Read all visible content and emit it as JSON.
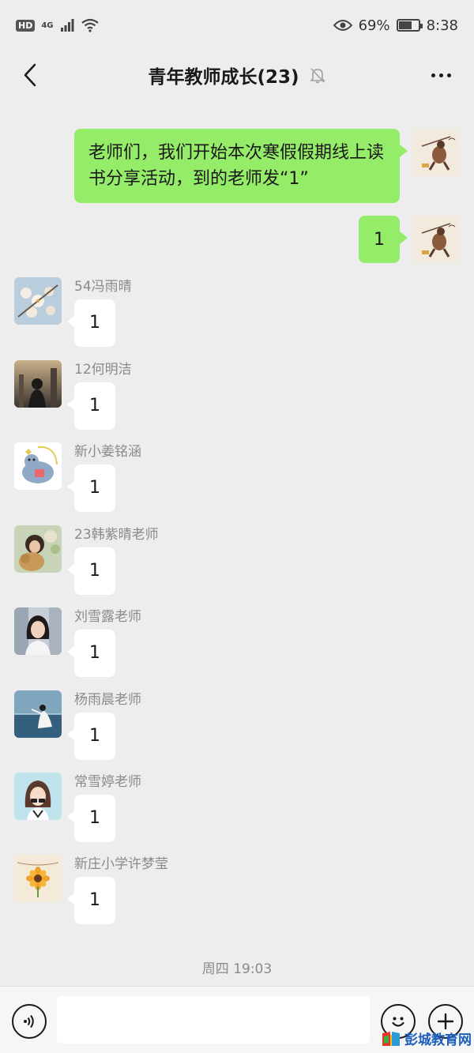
{
  "status_bar": {
    "hd": "HD",
    "network": "4G",
    "battery": "69%",
    "battery_level": 0.69,
    "time": "8:38"
  },
  "header": {
    "title": "青年教师成长(23)",
    "icons": [
      "back-chevron",
      "mute-bell",
      "more-dots"
    ]
  },
  "self_messages": [
    {
      "text": "老师们，我们开始本次寒假假期线上读书分享活动，到的老师发“1”"
    },
    {
      "text": "1"
    }
  ],
  "other_messages": [
    {
      "name": "54冯雨晴",
      "text": "1"
    },
    {
      "name": "12何明洁",
      "text": "1"
    },
    {
      "name": "新小姜铭涵",
      "text": "1"
    },
    {
      "name": "23韩紫晴老师",
      "text": "1"
    },
    {
      "name": "刘雪露老师",
      "text": "1"
    },
    {
      "name": "杨雨晨老师",
      "text": "1"
    },
    {
      "name": "常雪婷老师",
      "text": "1"
    },
    {
      "name": "新庄小学许梦莹",
      "text": "1"
    }
  ],
  "timestamp": "周四 19:03",
  "input_bar": {
    "placeholder": "",
    "icons": [
      "voice-icon",
      "emoji-icon",
      "plus-icon"
    ]
  },
  "watermark": "彭城教育网",
  "colors": {
    "background": "#ededed",
    "self_bubble": "#95ec69",
    "other_bubble": "#ffffff",
    "secondary_text": "#8a8a8a"
  }
}
